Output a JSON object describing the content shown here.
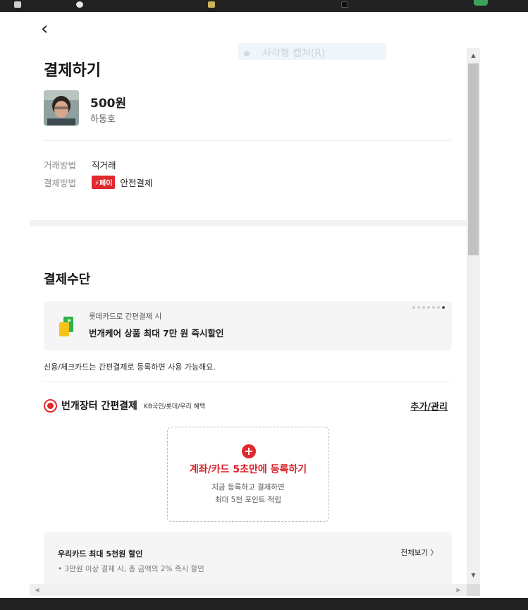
{
  "header": {
    "back_icon": "chevron-left-icon",
    "back_glyph": "‹"
  },
  "ghost_tooltip": {
    "label": "사각형 캡처(R)"
  },
  "page": {
    "title": "결제하기"
  },
  "product": {
    "price": "500원",
    "seller": "하동호"
  },
  "trade_info": [
    {
      "label": "거래방법",
      "value": "직거래"
    },
    {
      "label": "결제방법",
      "badge": "⚡페이",
      "value": "안전결제"
    }
  ],
  "payment_methods": {
    "title": "결제수단",
    "promo": {
      "sub": "롯데카드로 간편결제 시",
      "main": "번개케어 상품 최대 7만 원 즉시할인",
      "icon": "card-icon",
      "page_count": 7,
      "active_page": 7
    },
    "notice": "신용/체크카드는 간편결제로 등록하면 사용 가능해요.",
    "method": {
      "name": "번개장터 간편결제",
      "tag": "KB국민/롯데/우리 혜택",
      "manage": "추가/관리",
      "selected": true
    },
    "register": {
      "plus": "+",
      "title": "계좌/카드 5초만에 등록하기",
      "desc_line1": "지금 등록하고 결제하면",
      "desc_line2": "최대 5천 포인트 적립"
    },
    "benefit": {
      "title": "우리카드 최대 5천원 할인",
      "more": "전체보기 〉",
      "desc": "• 3만원 이상 결제 시, 총 금액의 2% 즉시 할인"
    }
  },
  "scrollbars": {
    "up": "▲",
    "down": "▼",
    "left": "◀",
    "right": "▶"
  },
  "colors": {
    "accent": "#e0282e",
    "accent_text": "#d92027",
    "panel": "#f5f5f5"
  }
}
